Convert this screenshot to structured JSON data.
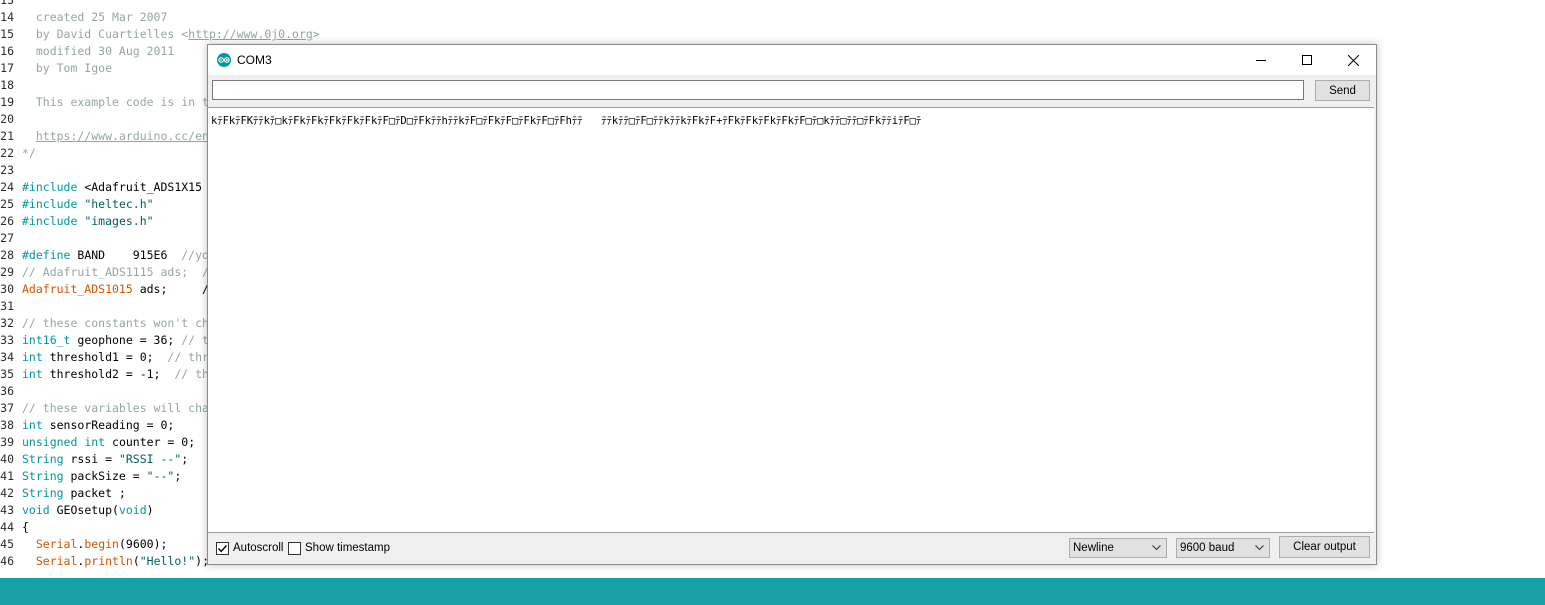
{
  "editor": {
    "lines": [
      {
        "n": "13",
        "parts": []
      },
      {
        "n": "14",
        "parts": [
          {
            "t": "  created 25 Mar 2007",
            "c": "comment"
          }
        ]
      },
      {
        "n": "15",
        "parts": [
          {
            "t": "  by David Cuartielles <",
            "c": "comment"
          },
          {
            "t": "http://www.0j0.org",
            "c": "link"
          },
          {
            "t": ">",
            "c": "comment"
          }
        ]
      },
      {
        "n": "16",
        "parts": [
          {
            "t": "  modified 30 Aug 2011",
            "c": "comment"
          }
        ]
      },
      {
        "n": "17",
        "parts": [
          {
            "t": "  by Tom Igoe",
            "c": "comment"
          }
        ]
      },
      {
        "n": "18",
        "parts": []
      },
      {
        "n": "19",
        "parts": [
          {
            "t": "  This example code is in t",
            "c": "comment"
          }
        ]
      },
      {
        "n": "20",
        "parts": []
      },
      {
        "n": "21",
        "parts": [
          {
            "t": "  ",
            "c": "comment"
          },
          {
            "t": "https://www.arduino.cc/en",
            "c": "link"
          }
        ]
      },
      {
        "n": "22",
        "parts": [
          {
            "t": "*/",
            "c": "comment"
          }
        ]
      },
      {
        "n": "23",
        "parts": []
      },
      {
        "n": "24",
        "parts": [
          {
            "t": "#include",
            "c": "kw"
          },
          {
            "t": " <Adafruit_ADS1X15",
            "c": ""
          }
        ]
      },
      {
        "n": "25",
        "parts": [
          {
            "t": "#include",
            "c": "kw"
          },
          {
            "t": " ",
            "c": ""
          },
          {
            "t": "\"heltec.h\"",
            "c": "str"
          }
        ]
      },
      {
        "n": "26",
        "parts": [
          {
            "t": "#include",
            "c": "kw"
          },
          {
            "t": " ",
            "c": ""
          },
          {
            "t": "\"images.h\"",
            "c": "str"
          }
        ]
      },
      {
        "n": "27",
        "parts": []
      },
      {
        "n": "28",
        "parts": [
          {
            "t": "#define",
            "c": "kw"
          },
          {
            "t": " BAND    915E6  ",
            "c": ""
          },
          {
            "t": "//yo",
            "c": "comment"
          }
        ]
      },
      {
        "n": "29",
        "parts": [
          {
            "t": "// Adafruit_ADS1115 ads;  /",
            "c": "comment"
          }
        ]
      },
      {
        "n": "30",
        "parts": [
          {
            "t": "Adafruit_ADS1015",
            "c": "lib"
          },
          {
            "t": " ads;     /",
            "c": ""
          }
        ]
      },
      {
        "n": "31",
        "parts": []
      },
      {
        "n": "32",
        "parts": [
          {
            "t": "// these constants won't ch",
            "c": "comment"
          }
        ]
      },
      {
        "n": "33",
        "parts": [
          {
            "t": "int16_t",
            "c": "type"
          },
          {
            "t": " geophone = 36; ",
            "c": ""
          },
          {
            "t": "// t",
            "c": "comment"
          }
        ]
      },
      {
        "n": "34",
        "parts": [
          {
            "t": "int",
            "c": "type"
          },
          {
            "t": " threshold1 = 0;  ",
            "c": ""
          },
          {
            "t": "// thr",
            "c": "comment"
          }
        ]
      },
      {
        "n": "35",
        "parts": [
          {
            "t": "int",
            "c": "type"
          },
          {
            "t": " threshold2 = -1;  ",
            "c": ""
          },
          {
            "t": "// th",
            "c": "comment"
          }
        ]
      },
      {
        "n": "36",
        "parts": []
      },
      {
        "n": "37",
        "parts": [
          {
            "t": "// these variables will cha",
            "c": "comment"
          }
        ]
      },
      {
        "n": "38",
        "parts": [
          {
            "t": "int",
            "c": "type"
          },
          {
            "t": " sensorReading = 0;",
            "c": ""
          }
        ]
      },
      {
        "n": "39",
        "parts": [
          {
            "t": "unsigned",
            "c": "type"
          },
          {
            "t": " ",
            "c": ""
          },
          {
            "t": "int",
            "c": "type"
          },
          {
            "t": " counter = 0;",
            "c": ""
          }
        ]
      },
      {
        "n": "40",
        "parts": [
          {
            "t": "String",
            "c": "type"
          },
          {
            "t": " rssi = ",
            "c": ""
          },
          {
            "t": "\"RSSI --\"",
            "c": "str"
          },
          {
            "t": ";",
            "c": ""
          }
        ]
      },
      {
        "n": "41",
        "parts": [
          {
            "t": "String",
            "c": "type"
          },
          {
            "t": " packSize = ",
            "c": ""
          },
          {
            "t": "\"--\"",
            "c": "str"
          },
          {
            "t": ";",
            "c": ""
          }
        ]
      },
      {
        "n": "42",
        "parts": [
          {
            "t": "String",
            "c": "type"
          },
          {
            "t": " packet ;",
            "c": ""
          }
        ]
      },
      {
        "n": "43",
        "parts": [
          {
            "t": "void",
            "c": "type"
          },
          {
            "t": " GEOsetup(",
            "c": ""
          },
          {
            "t": "void",
            "c": "type"
          },
          {
            "t": ")",
            "c": ""
          }
        ]
      },
      {
        "n": "44",
        "parts": [
          {
            "t": "{",
            "c": ""
          }
        ]
      },
      {
        "n": "45",
        "parts": [
          {
            "t": "  ",
            "c": ""
          },
          {
            "t": "Serial",
            "c": "lib"
          },
          {
            "t": ".",
            "c": ""
          },
          {
            "t": "begin",
            "c": "func"
          },
          {
            "t": "(9600);",
            "c": ""
          }
        ]
      },
      {
        "n": "46",
        "parts": [
          {
            "t": "  ",
            "c": ""
          },
          {
            "t": "Serial",
            "c": "lib"
          },
          {
            "t": ".",
            "c": ""
          },
          {
            "t": "println",
            "c": "func"
          },
          {
            "t": "(",
            "c": ""
          },
          {
            "t": "\"Hello!\"",
            "c": "str"
          },
          {
            "t": ");",
            "c": ""
          }
        ]
      }
    ]
  },
  "serial_monitor": {
    "title": "COM3",
    "input_value": "",
    "send_label": "Send",
    "output": "kﾃFkﾃFKﾃﾃkﾃ□kﾃFkﾃFkﾃFkﾃFkﾃFkﾃF□ﾃD□ﾃFkﾃﾃhﾃﾃkﾃF□ﾃFkﾃF□ﾃFkﾃF□ﾃFhﾃﾃ   ﾃﾃkﾃﾃ□ﾃF□ﾃﾃkﾃﾃkﾃFkﾃF+ﾃFkﾃFkﾃFkﾃFkﾃF□ﾃ□kﾃﾃ□ﾃﾃ□ﾃFkﾃﾃiﾃF□ﾃ",
    "autoscroll_label": "Autoscroll",
    "autoscroll_checked": true,
    "timestamp_label": "Show timestamp",
    "timestamp_checked": false,
    "line_ending": "Newline",
    "baud": "9600 baud",
    "clear_label": "Clear output"
  },
  "colors": {
    "status_bar": "#17a1a5",
    "arduino_teal": "#00979c"
  }
}
